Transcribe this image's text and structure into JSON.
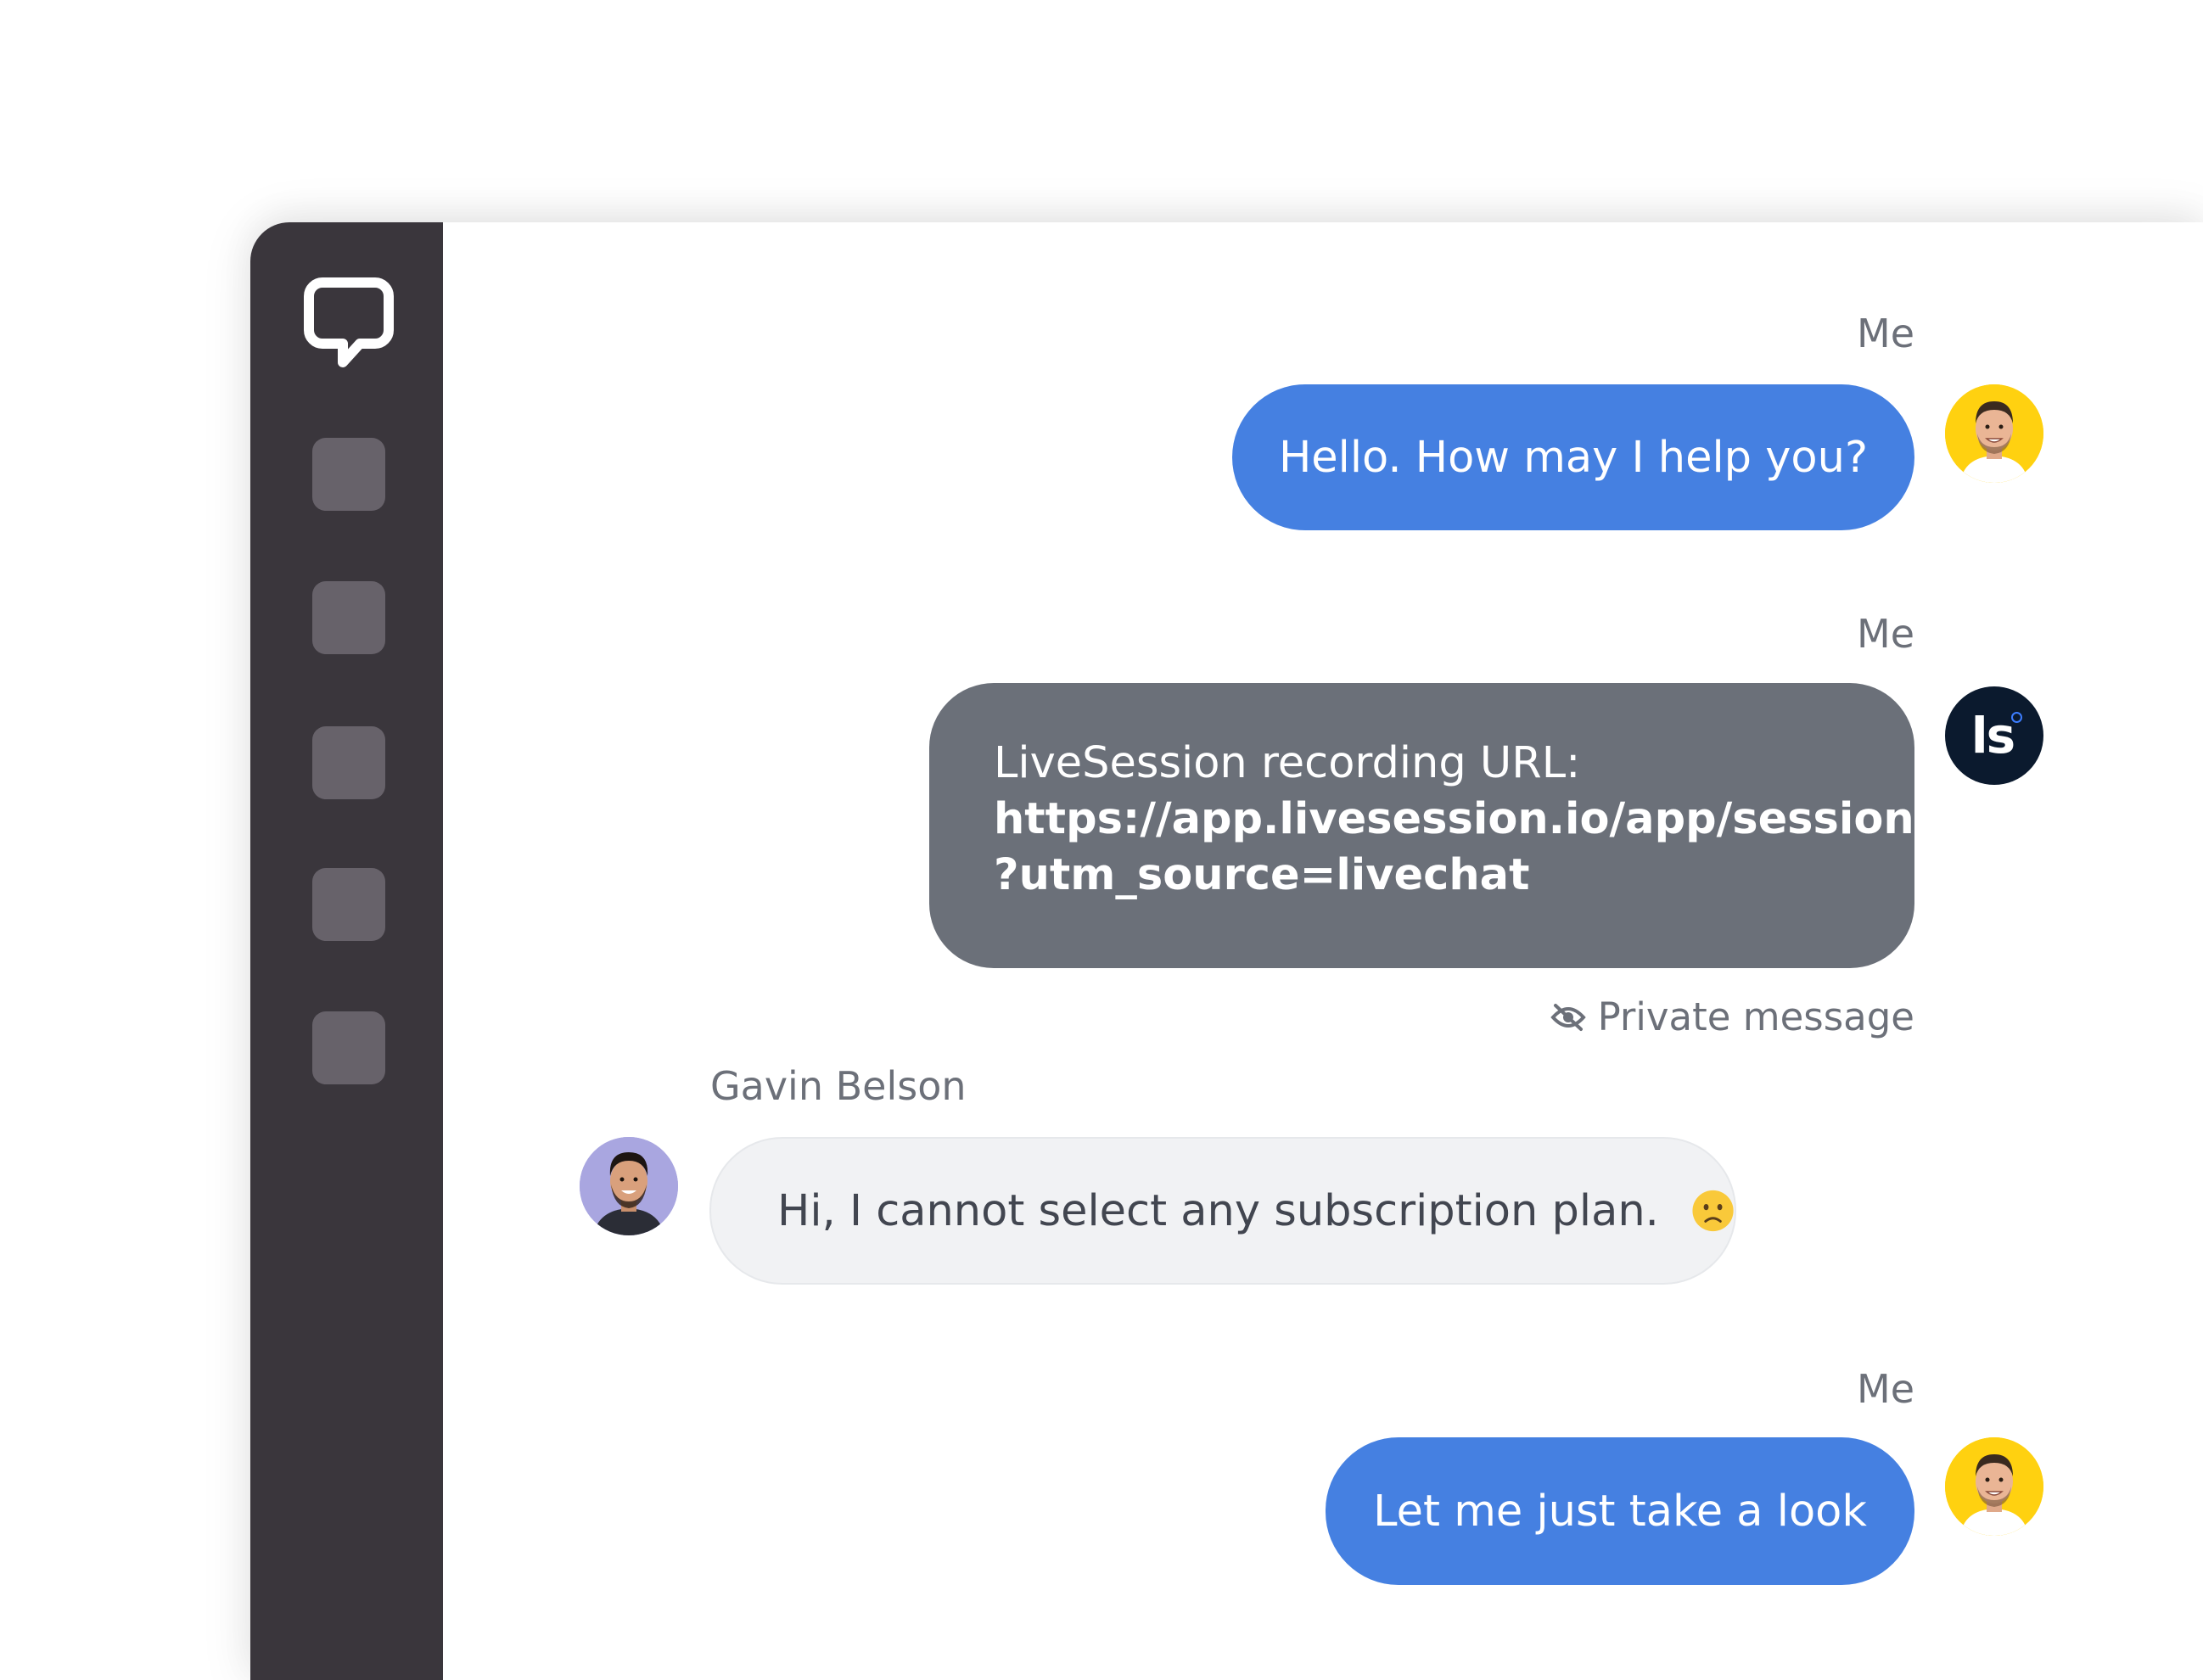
{
  "sidebar": {
    "logo": "livechat-logo-icon",
    "nav_items": [
      {
        "icon": "nav-placeholder-icon"
      },
      {
        "icon": "nav-placeholder-icon"
      },
      {
        "icon": "nav-placeholder-icon"
      },
      {
        "icon": "nav-placeholder-icon"
      },
      {
        "icon": "nav-placeholder-icon"
      }
    ]
  },
  "chat": {
    "messages": [
      {
        "sender": "Me",
        "text": "Hello. How may I help you?",
        "avatar": "agent-avatar"
      },
      {
        "sender": "Me",
        "heading": "LiveSession recording URL:",
        "url_line_1": "https://app.livesession.io/app/sessions//",
        "url_line_2": "?utm_source=livechat",
        "avatar": "livesession-avatar",
        "avatar_text": "ls",
        "private_label": "Private message",
        "private_icon": "eye-off-icon"
      },
      {
        "sender": "Gavin Belson",
        "text": "Hi, I cannot select any subscription plan.",
        "emoji": "frowning-face-icon",
        "avatar": "customer-avatar"
      },
      {
        "sender": "Me",
        "text": "Let me just take a look",
        "avatar": "agent-avatar"
      }
    ]
  },
  "colors": {
    "sidebar_bg": "#3a363c",
    "nav_item": "#67626a",
    "agent_bubble": "#4580e1",
    "private_bubble": "#6b7079",
    "customer_bubble": "#f1f2f4",
    "livesession_avatar_bg": "#0b1a2e",
    "agent_avatar_bg": "#ffd110",
    "customer_avatar_bg": "#a9a6e0"
  }
}
